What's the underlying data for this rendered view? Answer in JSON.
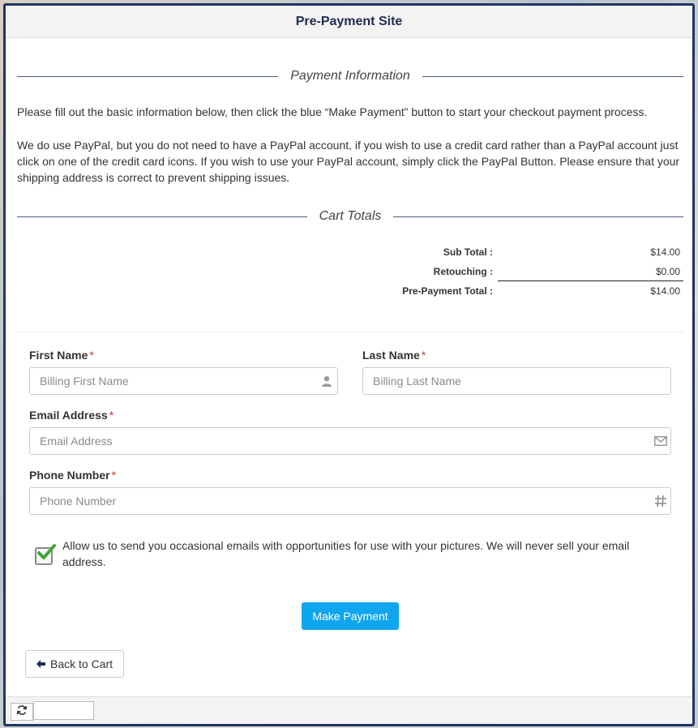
{
  "window": {
    "title": "Pre-Payment Site"
  },
  "payment_section": {
    "heading": "Payment Information",
    "paragraph1": "Please fill out the basic information below, then click the blue “Make Payment” button to start your checkout payment process.",
    "paragraph2": "We do use PayPal, but you do not need to have a PayPal account, if you wish to use a credit card rather than a PayPal account just click on one of the credit card icons. If you wish to use your PayPal account, simply click the PayPal Button. Please ensure that your shipping address is correct to prevent shipping issues."
  },
  "cart_section": {
    "heading": "Cart Totals",
    "rows": [
      {
        "label": "Sub Total :",
        "value": "$14.00"
      },
      {
        "label": "Retouching :",
        "value": "$0.00"
      },
      {
        "label": "Pre-Payment Total :",
        "value": "$14.00"
      }
    ]
  },
  "form": {
    "required_marker": "*",
    "first_name": {
      "label": "First Name",
      "placeholder": "Billing First Name",
      "value": ""
    },
    "last_name": {
      "label": "Last Name",
      "placeholder": "Billing Last Name",
      "value": ""
    },
    "email": {
      "label": "Email Address",
      "placeholder": "Email Address",
      "value": ""
    },
    "phone": {
      "label": "Phone Number",
      "placeholder": "Phone Number",
      "value": ""
    },
    "consent": {
      "checked": true,
      "text": "Allow us to send you occasional emails with opportunities for use with your pictures. We will never sell your email address."
    }
  },
  "buttons": {
    "make_payment": "Make Payment",
    "back_to_cart": "Back to Cart"
  },
  "icons": {
    "first_name": "user-icon",
    "email": "envelope-icon",
    "phone": "hash-icon",
    "back": "arrow-left-icon",
    "refresh": "refresh-icon",
    "checkbox_check": "check-icon"
  },
  "colors": {
    "frame_border": "#1f3463",
    "primary_button": "#10a6ef",
    "required": "#cc3333",
    "check_green": "#3fa535"
  }
}
